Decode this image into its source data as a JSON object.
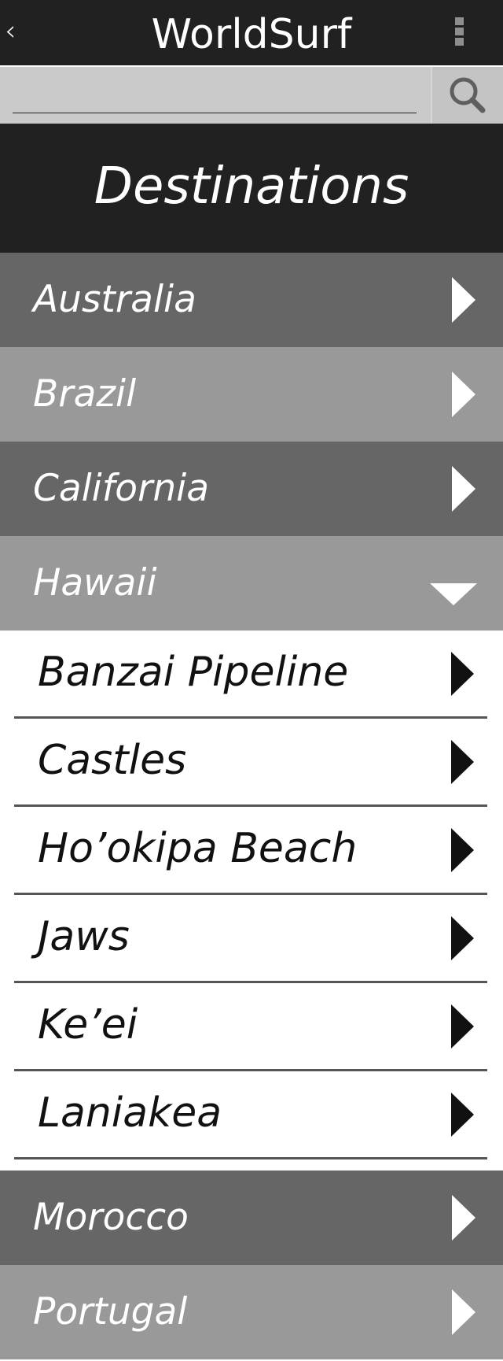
{
  "app": {
    "title": "WorldSurf",
    "back_glyph": "‹"
  },
  "search": {
    "value": "",
    "placeholder": "",
    "button_icon": "search-icon"
  },
  "page": {
    "heading": "Destinations"
  },
  "countries_before": [
    {
      "label": "Australia",
      "expanded": false
    },
    {
      "label": "Brazil",
      "expanded": false
    },
    {
      "label": "California",
      "expanded": false
    },
    {
      "label": "Hawaii",
      "expanded": true
    }
  ],
  "hawaii_spots": [
    {
      "label": "Banzai Pipeline"
    },
    {
      "label": "Castles"
    },
    {
      "label": "Ho’okipa Beach"
    },
    {
      "label": "Jaws"
    },
    {
      "label": "Ke’ei"
    },
    {
      "label": "Laniakea"
    }
  ],
  "countries_after": [
    {
      "label": "Morocco",
      "expanded": false
    },
    {
      "label": "Portugal",
      "expanded": false
    }
  ],
  "colors": {
    "bar": "#212121",
    "row_dark": "#666666",
    "row_light": "#999999",
    "search_bg": "#cacaca"
  }
}
